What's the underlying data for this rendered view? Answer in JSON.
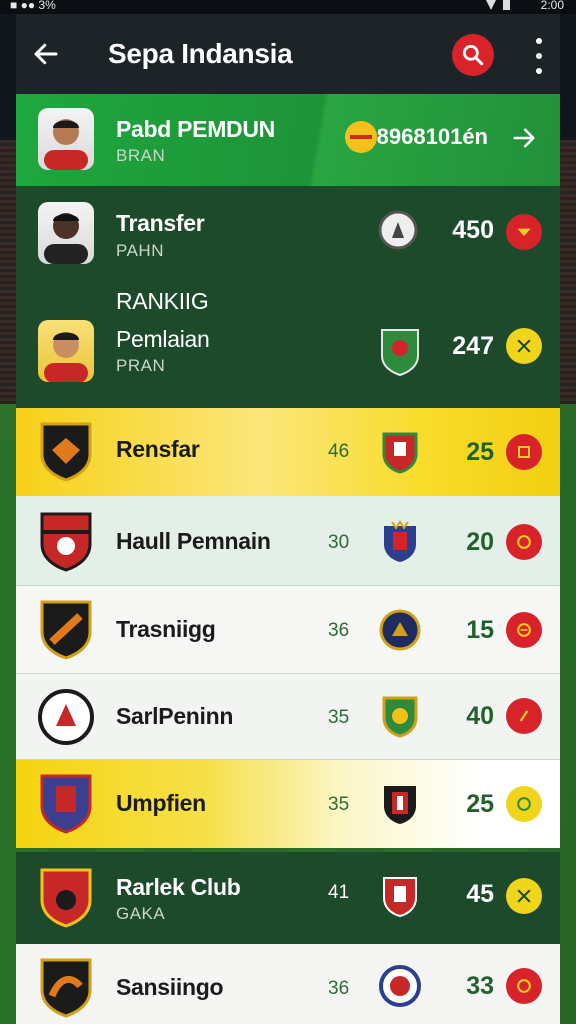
{
  "status_bar": {
    "left": "■ ●● 3%",
    "time": "2:00"
  },
  "header": {
    "title": "Sepa Indansia"
  },
  "rows": [
    {
      "name": "Pabd PEMDUN",
      "sub": "BRAN",
      "games": "",
      "points": "8968101én",
      "kind": "player",
      "action": "arrow"
    },
    {
      "name": "Transfer",
      "sub": "PAHN",
      "games": "",
      "points": "450",
      "kind": "player",
      "action": "chevron"
    },
    {
      "name_top": "RANKIIG",
      "name": "Pemlaian",
      "sub": "PRAN",
      "games": "",
      "points": "247",
      "kind": "player",
      "action": "close"
    },
    {
      "name": "Rensfar",
      "games": "46",
      "points": "25",
      "kind": "club",
      "action": "badge"
    },
    {
      "name": "Haull Pemnain",
      "games": "30",
      "points": "20",
      "kind": "club",
      "action": "badge"
    },
    {
      "name": "Trasniigg",
      "games": "36",
      "points": "15",
      "kind": "club",
      "action": "badge"
    },
    {
      "name": "SarlPeninn",
      "games": "35",
      "points": "40",
      "kind": "club",
      "action": "badge"
    },
    {
      "name": "Umpfien",
      "games": "35",
      "points": "25",
      "kind": "club",
      "action": "badge"
    },
    {
      "name": "Rarlek Club",
      "sub": "GAKA",
      "games": "41",
      "points": "45",
      "kind": "club",
      "action": "close"
    },
    {
      "name": "Sansiingo",
      "games": "36",
      "points": "33",
      "kind": "club",
      "action": "badge"
    }
  ],
  "colors": {
    "header_bg": "#1c2428",
    "row_green": "#1e9b3c",
    "row_dark": "#1d4a2b",
    "row_yellow": "#f2d020",
    "row_white": "#f1f4ef",
    "action_red": "#d9232a",
    "action_yellow": "#f1d51a"
  }
}
